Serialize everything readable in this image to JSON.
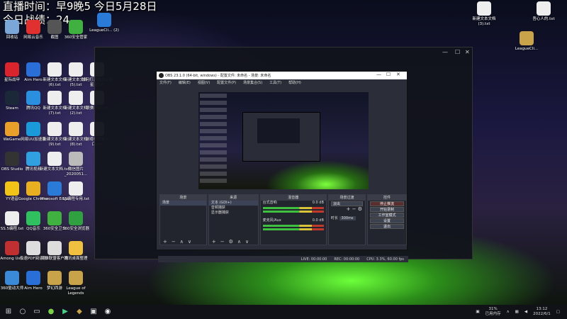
{
  "overlay": {
    "line1": "直播时间：早9晚5  今日5月28日",
    "line2": "今日战绩：24"
  },
  "desktop_icons": [
    {
      "label": "回收站",
      "color": "#7aa6d8"
    },
    {
      "label": "网易云音乐",
      "color": "#e03030"
    },
    {
      "label": "截图",
      "color": "#555555"
    },
    {
      "label": "360安全管家",
      "color": "#40b040"
    },
    {
      "label": "LeagueCli... (2)",
      "color": "#2a7ad8"
    },
    {
      "label": "新建文本文档 (3).txt",
      "color": "#eeeeee"
    },
    {
      "label": "吾心人的.txt",
      "color": "#eeeeee"
    },
    {
      "label": "LeagueCli...",
      "color": "#c9a34a"
    },
    {
      "label": "星际战甲",
      "color": "#d8242c"
    },
    {
      "label": "Aim Hero",
      "color": "#2a6fd8"
    },
    {
      "label": "新建文本文档 (6).txt",
      "color": "#eeeeee"
    },
    {
      "label": "新建文本文档 (5).txt",
      "color": "#eeeeee"
    },
    {
      "label": "如何打开出去上传星星.txt",
      "color": "#eeeeee"
    },
    {
      "label": "Steam",
      "color": "#1b2838"
    },
    {
      "label": "腾讯QQ",
      "color": "#2b8fe0"
    },
    {
      "label": "新建文本文档 (7).txt",
      "color": "#eeeeee"
    },
    {
      "label": "新建文本文档 (2).txt",
      "color": "#eeeeee"
    },
    {
      "label": "联赛视频.txt",
      "color": "#eeeeee"
    },
    {
      "label": "WeGame",
      "color": "#e8a02a"
    },
    {
      "label": "网易UU加速器",
      "color": "#1a9ad8"
    },
    {
      "label": "新建文本文档 (9).txt",
      "color": "#eeeeee"
    },
    {
      "label": "新建文本文档 (8).txt",
      "color": "#eeeeee"
    },
    {
      "label": "游戏中登录入口.txt",
      "color": "#eeeeee"
    },
    {
      "label": "OBS Studio",
      "color": "#333333"
    },
    {
      "label": "腾讯视频",
      "color": "#30a0e0"
    },
    {
      "label": "新建文本文档.txt",
      "color": "#eeeeee"
    },
    {
      "label": "微信图片_2020051...",
      "color": "#bbbbbb"
    },
    {
      "label": "YY语音",
      "color": "#f2c418"
    },
    {
      "label": "Google Chrome",
      "color": "#e8b020"
    },
    {
      "label": "Microsoft Edge",
      "color": "#2a7ad8"
    },
    {
      "label": "SS编程专用.txt",
      "color": "#eeeeee"
    },
    {
      "label": "SS.5编程.txt",
      "color": "#eeeeee"
    },
    {
      "label": "QQ音乐",
      "color": "#30c060"
    },
    {
      "label": "360安全卫士",
      "color": "#40b040"
    },
    {
      "label": "360安全浏览器",
      "color": "#30a040"
    },
    {
      "label": "Among Us...",
      "color": "#c03030"
    },
    {
      "label": "极速PDF阅读器",
      "color": "#dddddd"
    },
    {
      "label": "英雄联盟客户端",
      "color": "#dddddd"
    },
    {
      "label": "腾讯桌面整理",
      "color": "#f0c040"
    },
    {
      "label": "360驱动大师",
      "color": "#3a8ad8"
    },
    {
      "label": "Aim Hero",
      "color": "#2a6fd8"
    },
    {
      "label": "梦幻西游",
      "color": "#c9a34a"
    },
    {
      "label": "League of Legends",
      "color": "#c9a34a"
    }
  ],
  "obs": {
    "title": "OBS 23.1.0 (64-bit, windows) - 配置文件: 未命名 - 场景: 未命名",
    "menu": [
      "文件(F)",
      "编辑(E)",
      "视图(V)",
      "配置文件(P)",
      "场景集合(S)",
      "工具(T)",
      "帮助(H)"
    ],
    "docks": {
      "scenes": {
        "header": "场景",
        "items": [
          "场景"
        ]
      },
      "sources": {
        "header": "来源",
        "items": [
          "文本 (GDI+)",
          "音频捕获",
          "显示器捕获"
        ]
      },
      "mixer": {
        "header": "混音器",
        "channels": [
          {
            "name": "台式音响",
            "db": "0.0 dB"
          },
          {
            "name": "麦克风/Aux",
            "db": "0.0 dB"
          }
        ]
      },
      "transitions": {
        "header": "场景过渡",
        "type": "淡出",
        "duration_label": "时长",
        "duration": "300ms"
      },
      "controls": {
        "header": "控件",
        "buttons": [
          "停止推流",
          "开始录制",
          "工作室模式",
          "设置",
          "退出"
        ]
      }
    },
    "status": {
      "live": "LIVE: 00:00:00",
      "rec": "REC: 00:00:00",
      "cpu": "CPU: 3.3%, 60.00 fps"
    }
  },
  "taskbar": {
    "battery": "31%",
    "battery_sub": "已用内存",
    "time": "13:12",
    "date": "2022/6/1"
  }
}
